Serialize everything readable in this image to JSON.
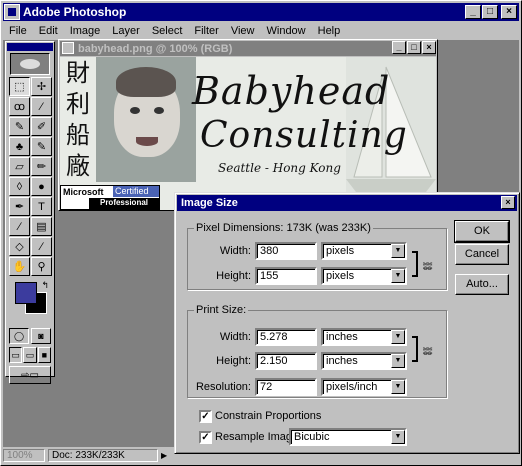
{
  "app": {
    "title": "Adobe Photoshop"
  },
  "menu": [
    "File",
    "Edit",
    "Image",
    "Layer",
    "Select",
    "Filter",
    "View",
    "Window",
    "Help"
  ],
  "document": {
    "title": "babyhead.png @ 100% (RGB)",
    "chinese_chars": [
      "財",
      "利",
      "船",
      "廠"
    ],
    "brand_line1": "Babyhead",
    "brand_line2": "Consulting",
    "brand_line3": "Seattle - Hong Kong",
    "badge_microsoft": "Microsoft",
    "badge_certified": "Certified",
    "badge_professional": "Professional"
  },
  "dialog": {
    "title": "Image Size",
    "pixel_group_label": "Pixel Dimensions: 173K (was 233K)",
    "width_label": "Width:",
    "width_value": "380",
    "width_unit": "pixels",
    "height_label": "Height:",
    "height_value": "155",
    "height_unit": "pixels",
    "print_group_label": "Print Size:",
    "print_width_label": "Width:",
    "print_width_value": "5.278",
    "print_width_unit": "inches",
    "print_height_label": "Height:",
    "print_height_value": "2.150",
    "print_height_unit": "inches",
    "resolution_label": "Resolution:",
    "resolution_value": "72",
    "resolution_unit": "pixels/inch",
    "constrain_label": "Constrain Proportions",
    "constrain_checked": true,
    "resample_label": "Resample Image:",
    "resample_checked": true,
    "resample_method": "Bicubic",
    "ok_label": "OK",
    "cancel_label": "Cancel",
    "auto_label": "Auto..."
  },
  "status": {
    "zoom": "100%",
    "doc_size": "Doc: 233K/233K"
  },
  "colors": {
    "foreground": "#3c3c9e",
    "background": "#000000",
    "title_active": "#000080",
    "title_inactive": "#808080"
  }
}
